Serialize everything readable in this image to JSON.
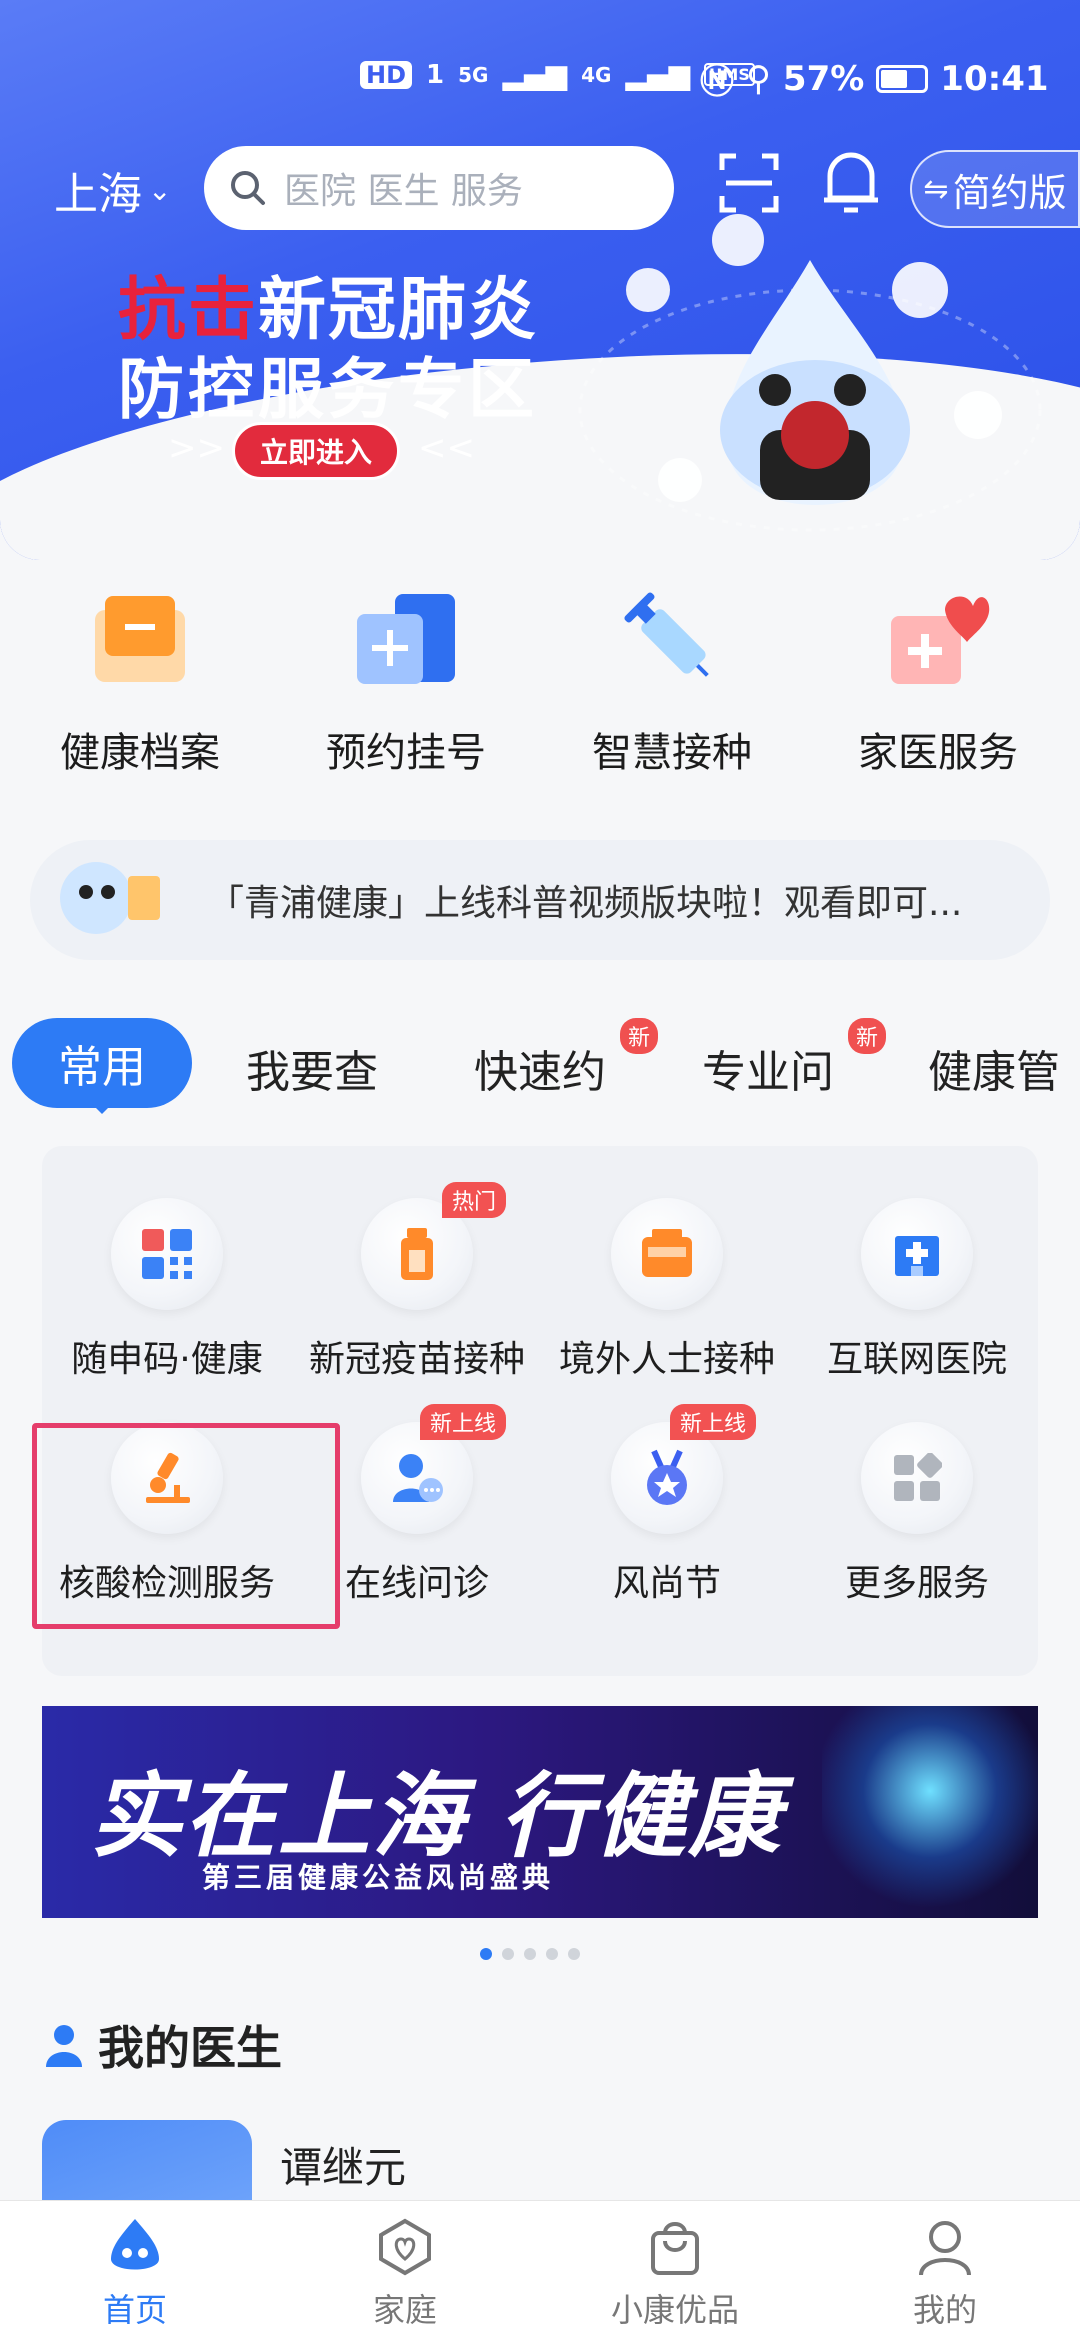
{
  "status_bar": {
    "hd_tag": "HD",
    "sim": "1",
    "net1": "5G",
    "net2": "4G",
    "hms": "HMS",
    "battery": "57%",
    "time": "10:41"
  },
  "header": {
    "city": "上海",
    "search_placeholder": "医院 医生 服务",
    "simple_mode": "简约版",
    "banner_title_red": "抗击",
    "banner_title_rest": "新冠肺炎",
    "banner_subtitle": "防控服务专区",
    "banner_button": "立即进入"
  },
  "quick_services": [
    {
      "label": "健康档案",
      "icon": "folder-icon"
    },
    {
      "label": "预约挂号",
      "icon": "registration-icon"
    },
    {
      "label": "智慧接种",
      "icon": "syringe-icon"
    },
    {
      "label": "家医服务",
      "icon": "family-doctor-icon"
    }
  ],
  "notice": {
    "text": "「青浦健康」上线科普视频版块啦！观看即可..."
  },
  "tabs": [
    {
      "label": "常用",
      "active": true
    },
    {
      "label": "我要查"
    },
    {
      "label": "快速约",
      "badge": "新"
    },
    {
      "label": "专业问",
      "badge": "新"
    },
    {
      "label": "健康管"
    }
  ],
  "services": [
    {
      "label": "随申码·健康",
      "icon": "qr-code-icon"
    },
    {
      "label": "新冠疫苗接种",
      "icon": "vaccine-icon",
      "badge": "热门"
    },
    {
      "label": "境外人士接种",
      "icon": "covid-vaccine-icon"
    },
    {
      "label": "互联网医院",
      "icon": "hospital-icon"
    },
    {
      "label": "核酸检测服务",
      "icon": "microscope-icon"
    },
    {
      "label": "在线问诊",
      "icon": "doctor-chat-icon",
      "badge": "新上线"
    },
    {
      "label": "风尚节",
      "icon": "medal-icon",
      "badge": "新上线"
    },
    {
      "label": "更多服务",
      "icon": "more-grid-icon"
    }
  ],
  "promo": {
    "title": "实在上海 行健康",
    "subtitle": "第三届健康公益风尚盛典"
  },
  "my_doctor": {
    "title": "我的医生",
    "doctor_name": "谭继元"
  },
  "bottom_nav": [
    {
      "label": "首页",
      "active": true
    },
    {
      "label": "家庭"
    },
    {
      "label": "小康优品"
    },
    {
      "label": "我的"
    }
  ],
  "colors": {
    "primary": "#2d7bf5",
    "highlight": "#e53d6b",
    "badge": "#f25252"
  }
}
